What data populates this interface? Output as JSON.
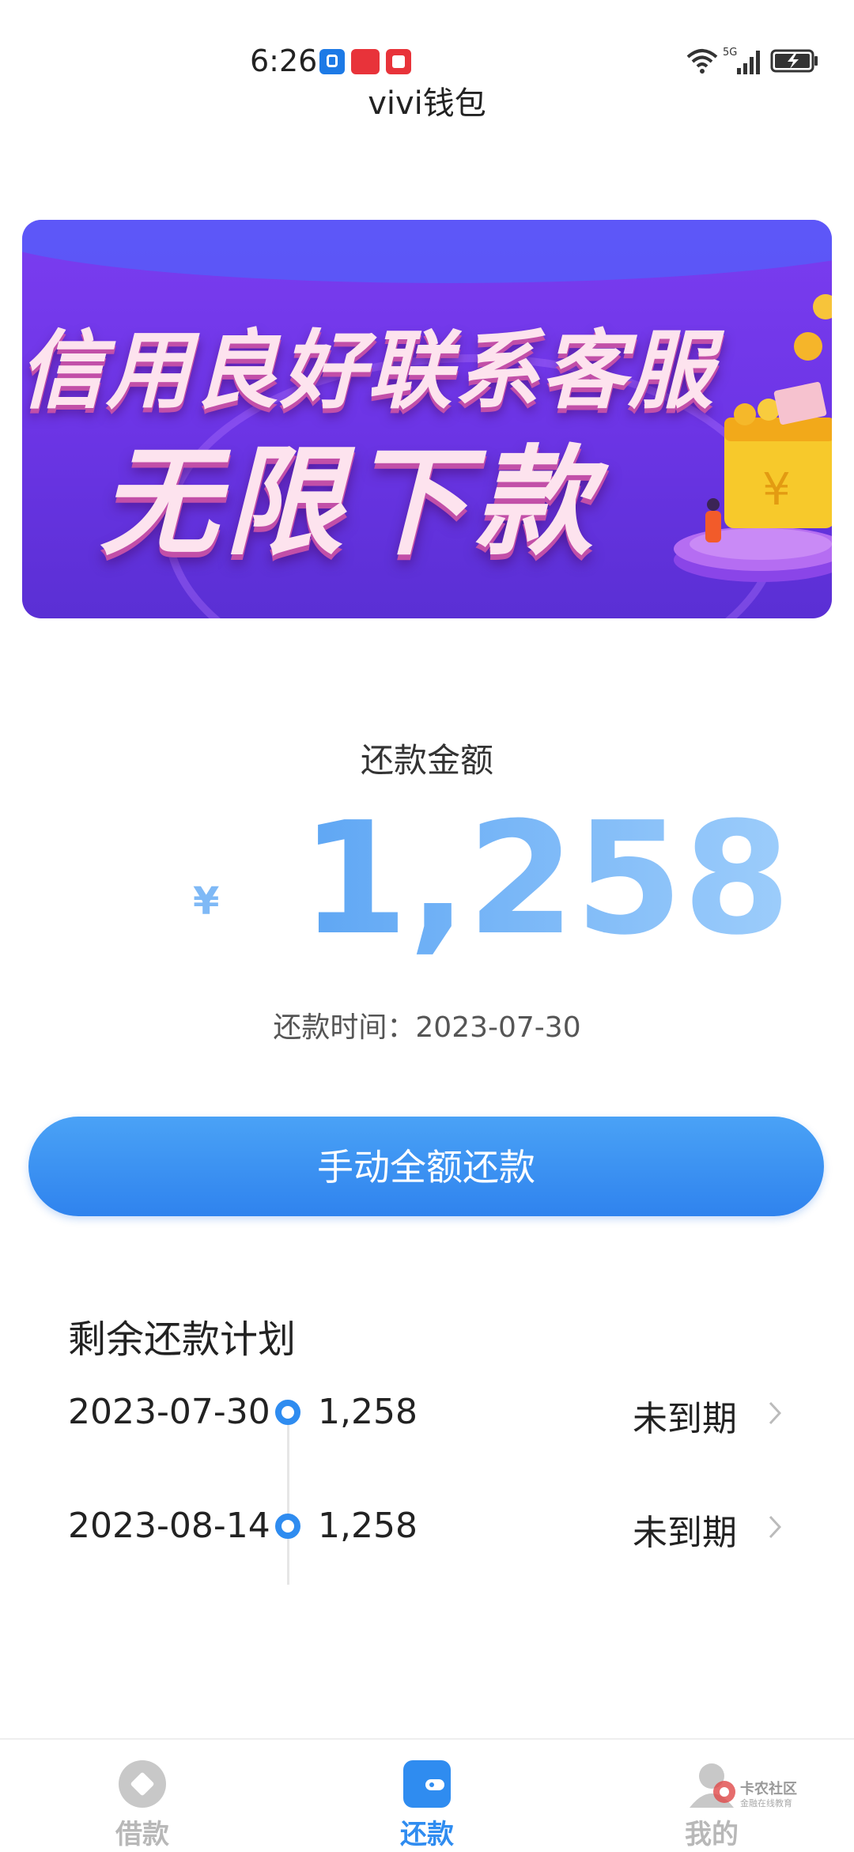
{
  "status_bar": {
    "time": "6:26",
    "network": "5G",
    "icons": [
      "app-notification-icon",
      "app-notification-icon",
      "app-notification-icon",
      "wifi-icon",
      "signal-icon",
      "battery-charging-icon"
    ]
  },
  "app": {
    "title": "vivi钱包"
  },
  "banner": {
    "line1": "信用良好联系客服",
    "line2": "无限下款",
    "wallet_symbol": "¥"
  },
  "repayment": {
    "label": "还款金额",
    "currency": "¥",
    "amount": "1,258",
    "due_label": "还款时间：",
    "due_date": "2023-07-30",
    "due_text": "还款时间：2023-07-30"
  },
  "pay_button": {
    "label": "手动全额还款"
  },
  "plan": {
    "title": "剩余还款计划",
    "items": [
      {
        "date": "2023-07-30",
        "amount": "1,258",
        "status": "未到期"
      },
      {
        "date": "2023-08-14",
        "amount": "1,258",
        "status": "未到期"
      }
    ]
  },
  "nav": {
    "items": [
      {
        "label": "借款",
        "icon": "borrow-icon",
        "active": false
      },
      {
        "label": "还款",
        "icon": "wallet-icon",
        "active": true
      },
      {
        "label": "我的",
        "icon": "profile-icon",
        "active": false
      }
    ]
  },
  "watermark": {
    "text": "卡农社区",
    "sub": "金融在线教育"
  },
  "colors": {
    "accent": "#2f8cf0",
    "amount": "#7eb8f7",
    "banner": "#6d35e6"
  }
}
